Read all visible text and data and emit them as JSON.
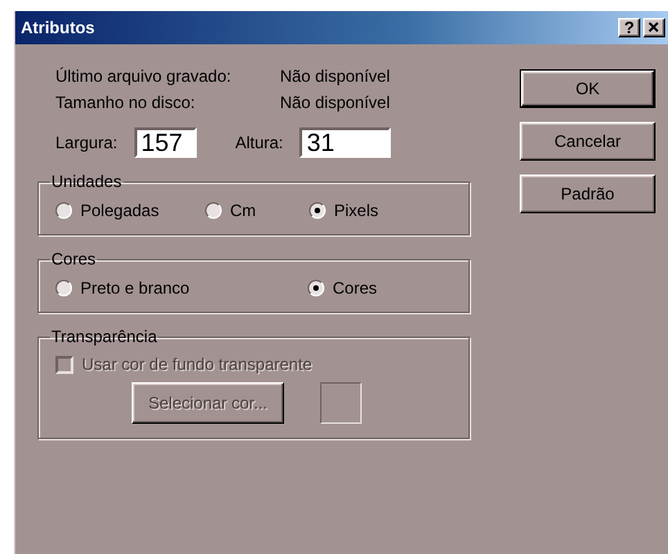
{
  "window": {
    "title": "Atributos",
    "help_button": "?"
  },
  "info": [
    {
      "label": "Último arquivo gravado:",
      "value": "Não disponível"
    },
    {
      "label": "Tamanho no disco:",
      "value": "Não disponível"
    }
  ],
  "size_fields": [
    {
      "label": "Largura:",
      "value": "157"
    },
    {
      "label": "Altura:",
      "value": "31"
    }
  ],
  "groups": [
    {
      "title": "Unidades",
      "items": [
        {
          "kind": "radio",
          "label": "Polegadas",
          "selected": false
        },
        {
          "kind": "radio",
          "label": "Cm",
          "selected": false
        },
        {
          "kind": "radio",
          "label": "Pixels",
          "selected": true
        }
      ]
    },
    {
      "title": "Cores",
      "items": [
        {
          "kind": "radio",
          "label": "Preto e branco",
          "selected": false
        },
        {
          "kind": "radio",
          "label": "Cores",
          "selected": true
        }
      ]
    },
    {
      "title": "Transparência",
      "items": [
        {
          "kind": "checkbox",
          "label": "Usar cor de fundo transparente",
          "checked": false,
          "disabled": true
        },
        {
          "kind": "color_button",
          "label": "Selecionar cor...",
          "disabled": true
        }
      ]
    }
  ],
  "buttons": [
    {
      "label": "OK",
      "default": true
    },
    {
      "label": "Cancelar",
      "default": false
    },
    {
      "label": "Padrão",
      "default": false
    }
  ]
}
